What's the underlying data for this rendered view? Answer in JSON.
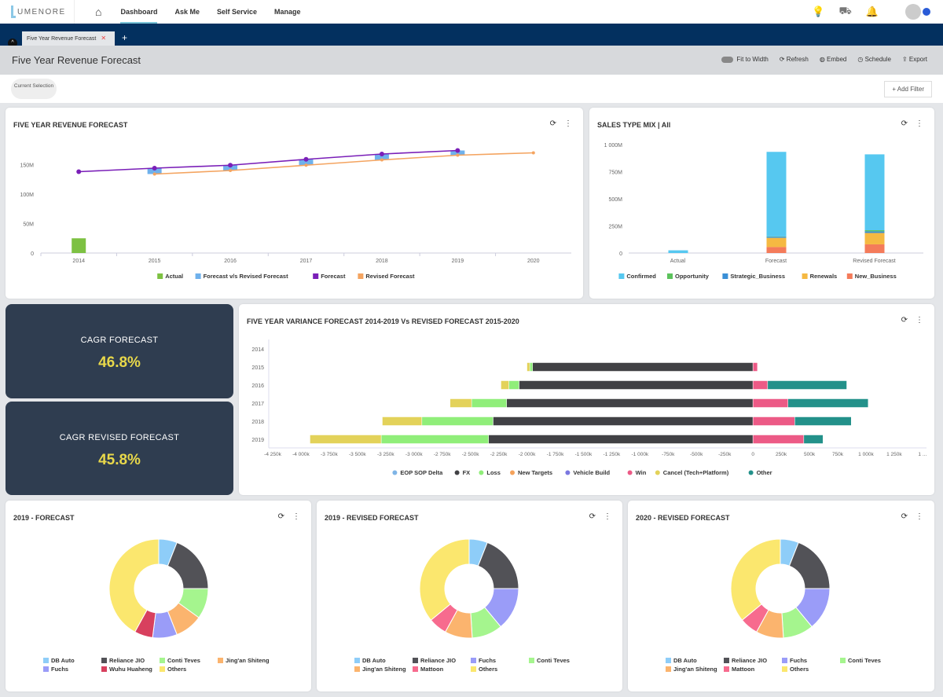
{
  "nav": {
    "logo": "UMENORE",
    "items": [
      "Dashboard",
      "Ask Me",
      "Self Service",
      "Manage"
    ],
    "active": "Dashboard"
  },
  "tabs": {
    "items": [
      "Five Year Revenue Forecast"
    ],
    "add": "+"
  },
  "page": {
    "title": "Five Year Revenue Forecast",
    "fit_to_width": "Fit to Width",
    "refresh": "Refresh",
    "embed": "Embed",
    "schedule": "Schedule",
    "export": "Export",
    "current_selection": "Current Selection",
    "add_filter": "+ Add Filter"
  },
  "kpis": [
    {
      "label": "CAGR FORECAST",
      "value": "46.8%"
    },
    {
      "label": "CAGR REVISED FORECAST",
      "value": "45.8%"
    }
  ],
  "colors": {
    "kpi_bg": "#2f3d50",
    "kpi_value": "#e8d84a",
    "tabbar": "#03305f"
  },
  "chart_data": [
    {
      "id": "revenue",
      "type": "line",
      "title": "FIVE YEAR REVENUE FORECAST",
      "categories": [
        "2014",
        "2015",
        "2016",
        "2017",
        "2018",
        "2019",
        "2020"
      ],
      "yticks": [
        "0",
        "50M",
        "100M",
        "150M"
      ],
      "ylim": [
        0,
        180
      ],
      "series": [
        {
          "name": "Actual",
          "type": "bar",
          "color": "#7dc142",
          "values": [
            25,
            null,
            null,
            null,
            null,
            null,
            null
          ]
        },
        {
          "name": "Forecast v/s Revised Forecast",
          "type": "range",
          "color": "#6fb1ec",
          "values": [
            null,
            [
              134,
              144
            ],
            [
              140,
              149
            ],
            [
              149,
              159
            ],
            [
              158,
              168
            ],
            [
              166,
              174
            ],
            null
          ]
        },
        {
          "name": "Forecast",
          "type": "line",
          "color": "#7a1fb8",
          "values": [
            138,
            144,
            149,
            159,
            168,
            174,
            null
          ]
        },
        {
          "name": "Revised Forecast",
          "type": "line",
          "color": "#f4a460",
          "values": [
            null,
            134,
            140,
            149,
            158,
            166,
            170
          ]
        }
      ]
    },
    {
      "id": "salesmix",
      "type": "bar",
      "stacked": true,
      "title": "SALES TYPE MIX | All",
      "categories": [
        "Actual",
        "Forecast",
        "Revised Forecast"
      ],
      "yticks": [
        "0",
        "250M",
        "500M",
        "750M",
        "1 000M"
      ],
      "ylim": [
        0,
        1000
      ],
      "series": [
        {
          "name": "Confirmed",
          "color": "#56c8f0",
          "values": [
            25,
            780,
            700
          ]
        },
        {
          "name": "Opportunity",
          "color": "#5cc25c",
          "values": [
            0,
            3,
            10
          ]
        },
        {
          "name": "Strategic_Business",
          "color": "#3a8fd6",
          "values": [
            0,
            10,
            15
          ]
        },
        {
          "name": "Renewals",
          "color": "#f5b942",
          "values": [
            0,
            85,
            105
          ]
        },
        {
          "name": "New_Business",
          "color": "#f47b5a",
          "values": [
            0,
            55,
            80
          ]
        }
      ]
    },
    {
      "id": "variance",
      "type": "bar",
      "orientation": "horizontal",
      "stacked": true,
      "title": "FIVE YEAR VARIANCE FORECAST 2014-2019 Vs REVISED FORECAST 2015-2020",
      "categories": [
        "2014",
        "2015",
        "2016",
        "2017",
        "2018",
        "2019"
      ],
      "xlim": [
        -4250,
        1250
      ],
      "xticks": [
        "-4 250k",
        "-4 000k",
        "-3 750k",
        "-3 500k",
        "-3 250k",
        "-3 000k",
        "-2 750k",
        "-2 500k",
        "-2 250k",
        "-2 000k",
        "-1 750k",
        "-1 500k",
        "-1 250k",
        "-1 000k",
        "-750k",
        "-500k",
        "-250k",
        "0",
        "250k",
        "500k",
        "750k",
        "1 000k",
        "1 250k",
        "1 ..."
      ],
      "series": [
        {
          "name": "EOP SOP Delta",
          "color": "#7fb5e6",
          "values": [
            0,
            0,
            0,
            0,
            0,
            0
          ]
        },
        {
          "name": "FX",
          "color": "#414145",
          "values": [
            0,
            -1950,
            -2070,
            -2180,
            -2300,
            -2340
          ]
        },
        {
          "name": "Loss",
          "color": "#90ee7a",
          "values": [
            0,
            -25,
            -90,
            -310,
            -630,
            -950
          ]
        },
        {
          "name": "New Targets",
          "color": "#f5a35c",
          "values": [
            0,
            0,
            0,
            0,
            0,
            0
          ]
        },
        {
          "name": "Vehicle Build",
          "color": "#7b78e0",
          "values": [
            0,
            0,
            0,
            0,
            0,
            0
          ]
        },
        {
          "name": "Win",
          "color": "#ec5a86",
          "values": [
            0,
            40,
            130,
            310,
            370,
            450
          ]
        },
        {
          "name": "Cancel (Tech+Platform)",
          "color": "#e3d25a",
          "values": [
            0,
            -25,
            -70,
            -190,
            -350,
            -630
          ]
        },
        {
          "name": "Other",
          "color": "#23918a",
          "values": [
            0,
            0,
            700,
            710,
            500,
            170
          ]
        }
      ]
    },
    {
      "id": "pie1",
      "type": "pie",
      "donut": true,
      "title": "2019 - FORECAST",
      "slices": [
        {
          "name": "DB Auto",
          "value": 6,
          "color": "#8ecdf8"
        },
        {
          "name": "Reliance JIO",
          "value": 19,
          "color": "#525257"
        },
        {
          "name": "Conti Teves",
          "value": 10,
          "color": "#a5f58e"
        },
        {
          "name": "Jing'an Shiteng",
          "value": 9,
          "color": "#fbb46e"
        },
        {
          "name": "Fuchs",
          "value": 8,
          "color": "#9a9cf8"
        },
        {
          "name": "Wuhu Huaheng",
          "value": 6,
          "color": "#d8405e"
        },
        {
          "name": "Others",
          "value": 42,
          "color": "#fbe76e"
        }
      ]
    },
    {
      "id": "pie2",
      "type": "pie",
      "donut": true,
      "title": "2019 - REVISED FORECAST",
      "slices": [
        {
          "name": "DB Auto",
          "value": 6,
          "color": "#8ecdf8"
        },
        {
          "name": "Reliance JIO",
          "value": 19,
          "color": "#525257"
        },
        {
          "name": "Fuchs",
          "value": 14,
          "color": "#9a9cf8"
        },
        {
          "name": "Conti Teves",
          "value": 10,
          "color": "#a5f58e"
        },
        {
          "name": "Jing'an Shiteng",
          "value": 9,
          "color": "#fbb46e"
        },
        {
          "name": "Mattoon",
          "value": 6,
          "color": "#f76b8e"
        },
        {
          "name": "Others",
          "value": 36,
          "color": "#fbe76e"
        }
      ]
    },
    {
      "id": "pie3",
      "type": "pie",
      "donut": true,
      "title": "2020 - REVISED FORECAST",
      "slices": [
        {
          "name": "DB Auto",
          "value": 6,
          "color": "#8ecdf8"
        },
        {
          "name": "Reliance JIO",
          "value": 19,
          "color": "#525257"
        },
        {
          "name": "Fuchs",
          "value": 14,
          "color": "#9a9cf8"
        },
        {
          "name": "Conti Teves",
          "value": 10,
          "color": "#a5f58e"
        },
        {
          "name": "Jing'an Shiteng",
          "value": 9,
          "color": "#fbb46e"
        },
        {
          "name": "Mattoon",
          "value": 6,
          "color": "#f76b8e"
        },
        {
          "name": "Others",
          "value": 36,
          "color": "#fbe76e"
        }
      ]
    }
  ]
}
